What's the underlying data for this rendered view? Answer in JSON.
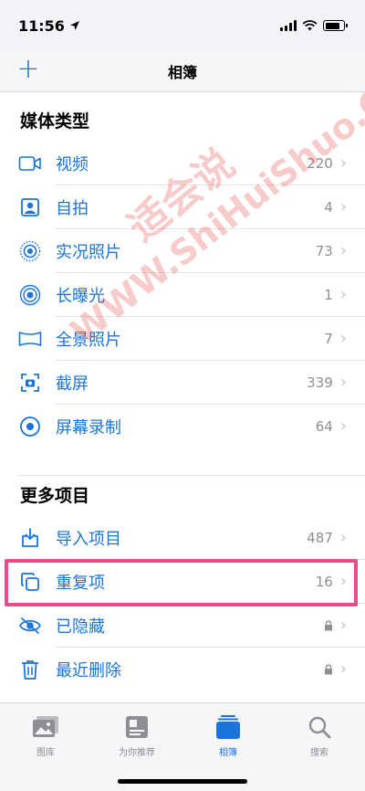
{
  "status_bar": {
    "time": "11:56"
  },
  "nav": {
    "add_label": "+",
    "title": "相簿"
  },
  "sections": [
    {
      "header": "媒体类型",
      "items": [
        {
          "label": "视频",
          "count": "220",
          "icon": "video-icon"
        },
        {
          "label": "自拍",
          "count": "4",
          "icon": "selfie-icon"
        },
        {
          "label": "实况照片",
          "count": "73",
          "icon": "live-photo-icon"
        },
        {
          "label": "长曝光",
          "count": "1",
          "icon": "long-exposure-icon"
        },
        {
          "label": "全景照片",
          "count": "7",
          "icon": "panorama-icon"
        },
        {
          "label": "截屏",
          "count": "339",
          "icon": "screenshot-icon"
        },
        {
          "label": "屏幕录制",
          "count": "64",
          "icon": "screen-recording-icon"
        }
      ]
    },
    {
      "header": "更多项目",
      "items": [
        {
          "label": "导入项目",
          "count": "487",
          "icon": "import-icon"
        },
        {
          "label": "重复项",
          "count": "16",
          "icon": "duplicates-icon"
        },
        {
          "label": "已隐藏",
          "icon": "hidden-icon",
          "locked": true
        },
        {
          "label": "最近删除",
          "icon": "trash-icon",
          "locked": true
        }
      ]
    }
  ],
  "tabs": [
    {
      "label": "图库",
      "icon": "library-icon",
      "active": false
    },
    {
      "label": "为你推荐",
      "icon": "for-you-icon",
      "active": false
    },
    {
      "label": "相簿",
      "icon": "albums-icon",
      "active": true
    },
    {
      "label": "搜索",
      "icon": "search-icon",
      "active": false
    }
  ],
  "watermark": {
    "line1": "WWW.ShiHuiShuo.Com",
    "line2": "适会说"
  },
  "colors": {
    "accent": "#1a74d9",
    "secondary": "#8e8e93",
    "highlight": "#e54d86",
    "watermark": "#e64646"
  }
}
